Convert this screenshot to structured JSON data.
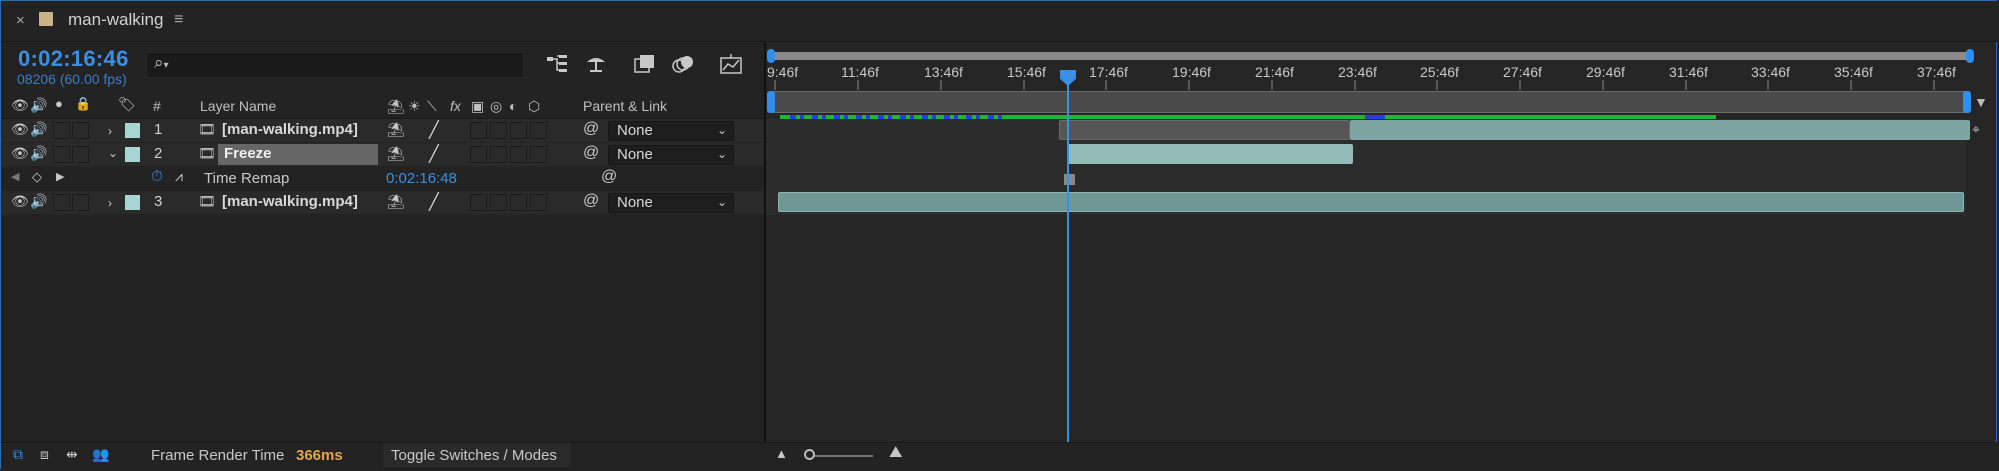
{
  "tab": {
    "close": "×",
    "title": "man-walking",
    "menu": "≡",
    "swatch_color": "#c9b288"
  },
  "current_time": "0:02:16:46",
  "frame_info": "08206 (60.00 fps)",
  "search": {
    "placeholder": "",
    "icon": "search-icon"
  },
  "toolbar_icons": [
    "composition-flowchart-icon",
    "draft-3d-icon",
    "frame-blending-icon",
    "motion-blur-icon",
    "graph-editor-icon"
  ],
  "column_headers": {
    "number": "#",
    "layer_name": "Layer Name",
    "parent_link": "Parent & Link",
    "fx": "fx"
  },
  "layers": [
    {
      "index": "1",
      "name": "[man-walking.mp4]",
      "parent": "None",
      "label_color": "#a7d6d2",
      "expanded": false
    },
    {
      "index": "2",
      "name": "Freeze",
      "parent": "None",
      "label_color": "#a7d6d2",
      "expanded": true
    },
    {
      "index": "3",
      "name": "[man-walking.mp4]",
      "parent": "None",
      "label_color": "#a7d6d2",
      "expanded": false
    }
  ],
  "time_remap": {
    "label": "Time Remap",
    "value": "0:02:16:48"
  },
  "ruler_labels": [
    "9:46f",
    "11:46f",
    "13:46f",
    "15:46f",
    "17:46f",
    "19:46f",
    "21:46f",
    "23:46f",
    "25:46f",
    "27:46f",
    "29:46f",
    "31:46f",
    "33:46f",
    "35:46f",
    "37:46f"
  ],
  "footer": {
    "frame_render_label": "Frame Render Time",
    "frame_render_value": "366ms",
    "toggle_label": "Toggle Switches / Modes"
  },
  "colors": {
    "accent": "#3a8fe6",
    "render_time": "#e3a64a",
    "cache_green": "#22b33a",
    "cache_blue": "#2b3fd8",
    "bar_teal": "#7ea5a3"
  }
}
